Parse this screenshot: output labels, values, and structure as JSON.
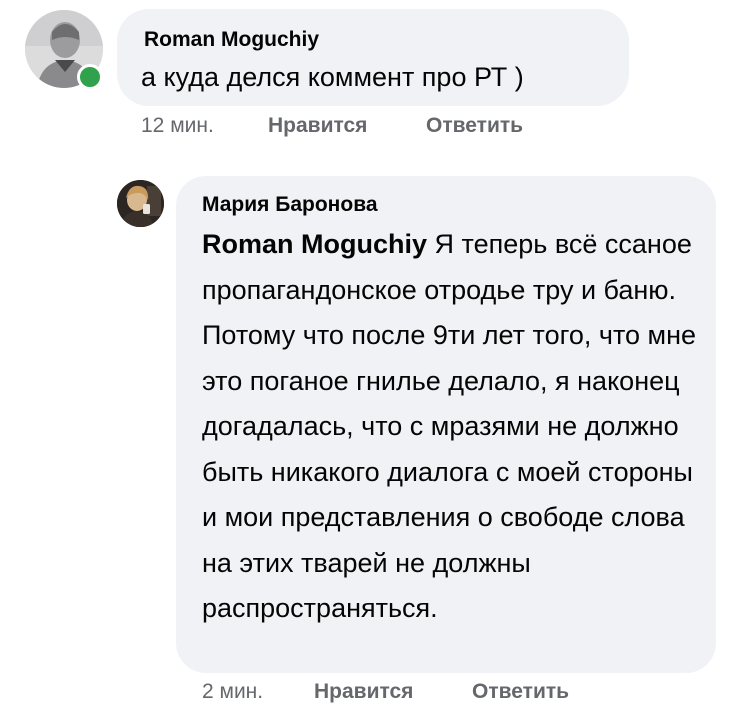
{
  "comment": {
    "author": "Roman Moguchiy",
    "text": "а куда делся коммент про РТ )",
    "time": "12 мин.",
    "like_label": "Нравится",
    "reply_label": "Ответить",
    "online": true
  },
  "reply": {
    "author": "Мария Баронова",
    "mention": "Roman Moguchiy",
    "text": "Я теперь всё ссаное пропагандонское отродье тру и баню. Потому что после 9ти лет того, что мне это поганое гнилье делало, я наконец догадалась, что с мразями не должно быть никакого диалога с моей стороны и мои представления о свободе слова на этих тварей не должны распространяться.",
    "time": "2 мин.",
    "like_label": "Нравится",
    "reply_label": "Ответить"
  },
  "colors": {
    "bubble": "#f0f2f5",
    "meta_text": "#65676b",
    "online_dot": "#31a24c"
  }
}
